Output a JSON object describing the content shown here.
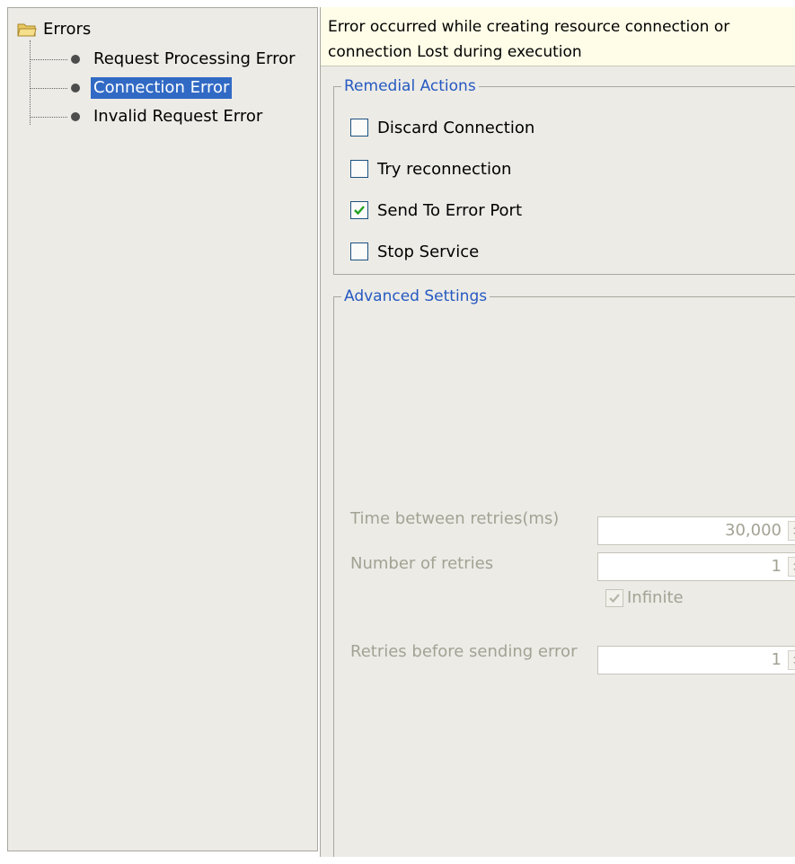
{
  "tree": {
    "root_label": "Errors",
    "items": [
      {
        "label": "Request Processing Error",
        "selected": false
      },
      {
        "label": "Connection Error",
        "selected": true
      },
      {
        "label": "Invalid Request Error",
        "selected": false
      }
    ]
  },
  "description": {
    "line1": "Error occurred while creating resource connection or",
    "line2": "connection Lost during execution"
  },
  "remedial_actions": {
    "legend": "Remedial Actions",
    "options": [
      {
        "label": "Discard Connection",
        "checked": false
      },
      {
        "label": "Try reconnection",
        "checked": false
      },
      {
        "label": "Send To Error Port",
        "checked": true
      },
      {
        "label": "Stop Service",
        "checked": false
      }
    ]
  },
  "advanced_settings": {
    "legend": "Advanced Settings",
    "time_between_retries_label": "Time between retries(ms)",
    "time_between_retries_value": "30,000",
    "number_of_retries_label": "Number of retries",
    "number_of_retries_value": "1",
    "infinite_label": "Infinite",
    "infinite_checked": true,
    "retries_before_error_label": "Retries before sending error",
    "retries_before_error_value": "1"
  },
  "colors": {
    "selection": "#316ac5",
    "legend_text": "#2559c2",
    "disabled_text": "#a3a294",
    "panel_bg": "#ecebe6",
    "description_bg": "#fffde8"
  }
}
